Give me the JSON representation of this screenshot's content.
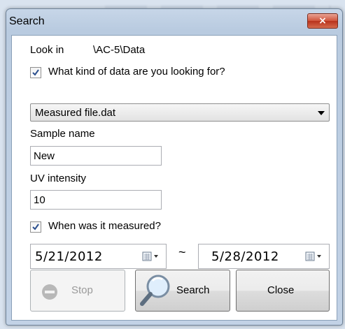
{
  "window": {
    "title": "Search"
  },
  "look_in": {
    "label": "Look in",
    "value": "\\AC-5\\Data"
  },
  "data_kind": {
    "label": "What kind of data are you  looking for?",
    "checked": true,
    "selected": "Measured file.dat"
  },
  "sample": {
    "label": "Sample name",
    "value": "New"
  },
  "uv": {
    "label": "UV intensity",
    "value": "10"
  },
  "measured": {
    "label": "When was it measured?",
    "checked": true,
    "from": "5/21/2012",
    "to": "5/28/2012",
    "separator": "~"
  },
  "buttons": {
    "stop": "Stop",
    "search": "Search",
    "close": "Close"
  },
  "colors": {
    "check": "#2b4f8e",
    "title_close": "#c9452e"
  }
}
